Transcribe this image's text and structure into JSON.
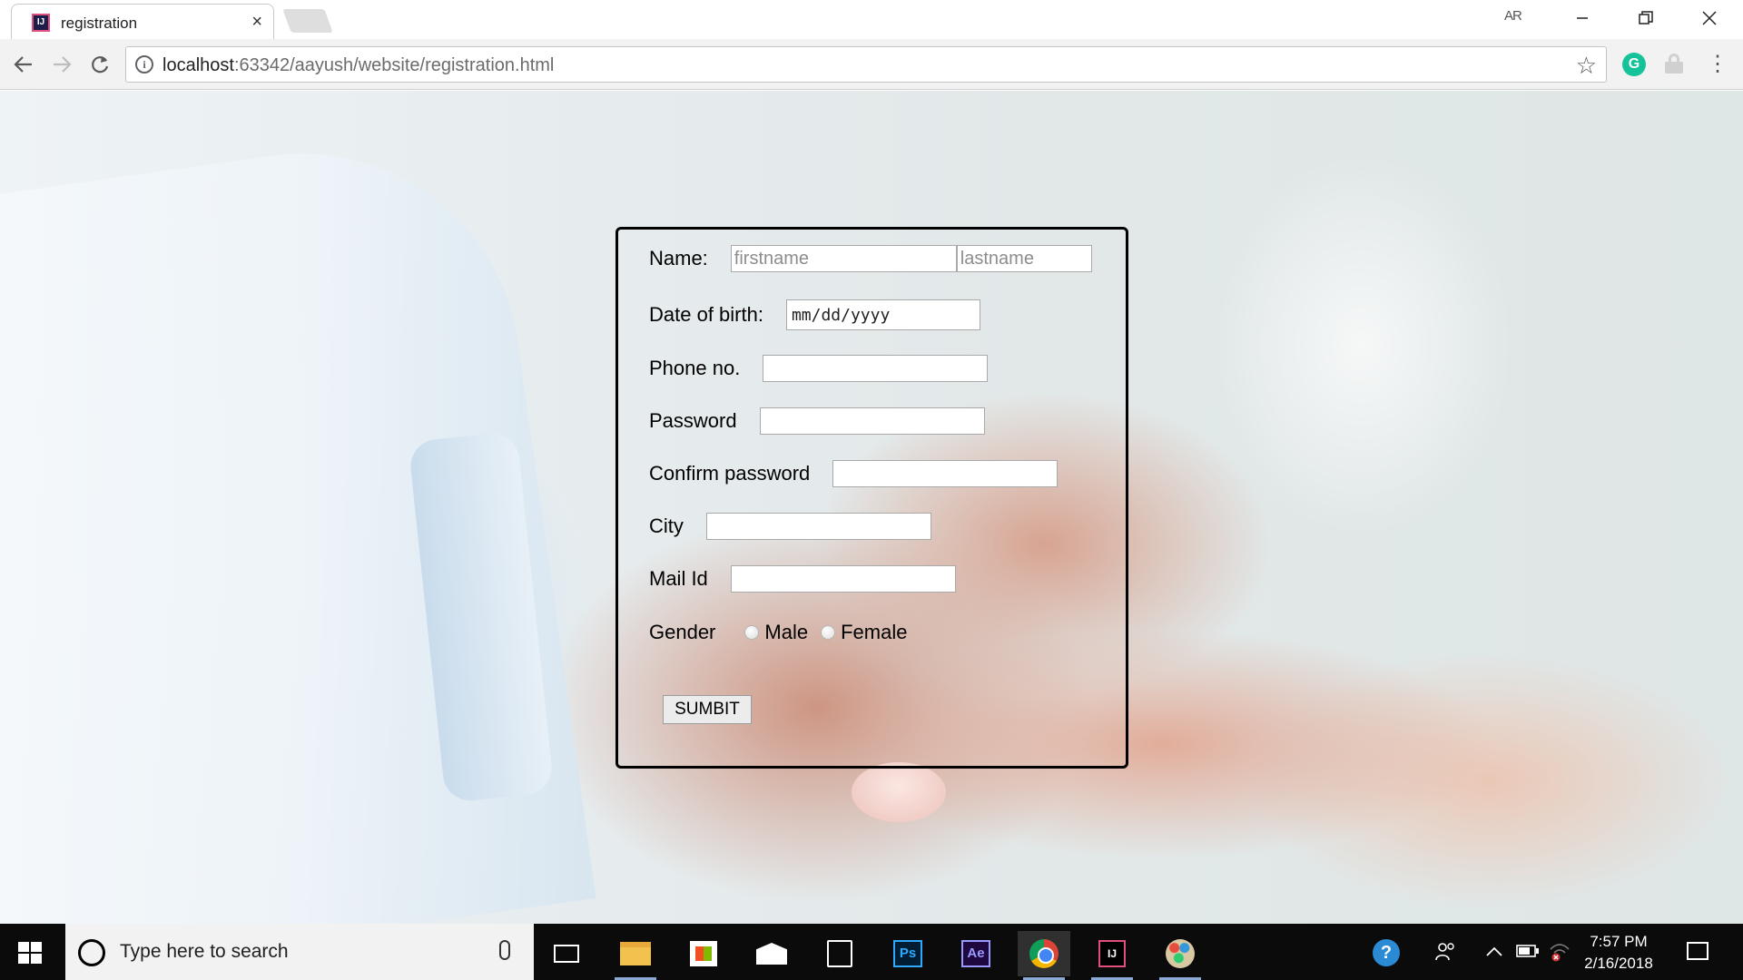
{
  "browser": {
    "tab_title": "registration",
    "tab_close": "×",
    "profile_badge": "AR",
    "url_host": "localhost",
    "url_rest": ":63342/aayush/website/registration.html"
  },
  "form": {
    "name_label": "Name:",
    "firstname_placeholder": "firstname",
    "lastname_placeholder": "lastname",
    "dob_label": "Date of birth:",
    "dob_value": "mm/dd/yyyy",
    "phone_label": "Phone no.",
    "password_label": "Password",
    "confirm_label": "Confirm password",
    "city_label": "City",
    "mail_label": "Mail Id",
    "gender_label": "Gender",
    "gender_options": [
      "Male",
      "Female"
    ],
    "submit_label": "SUMBIT"
  },
  "taskbar": {
    "search_placeholder": "Type here to search",
    "time": "7:57 PM",
    "date": "2/16/2018"
  },
  "icons": {
    "photoshop_text": "Ps",
    "after_effects_text": "Ae",
    "intellij_text": "IJ",
    "grammarly_text": "G"
  },
  "colors": {
    "form_border": "#000000",
    "taskbar_bg": "#0b0b0b",
    "grammarly": "#15c39a"
  }
}
